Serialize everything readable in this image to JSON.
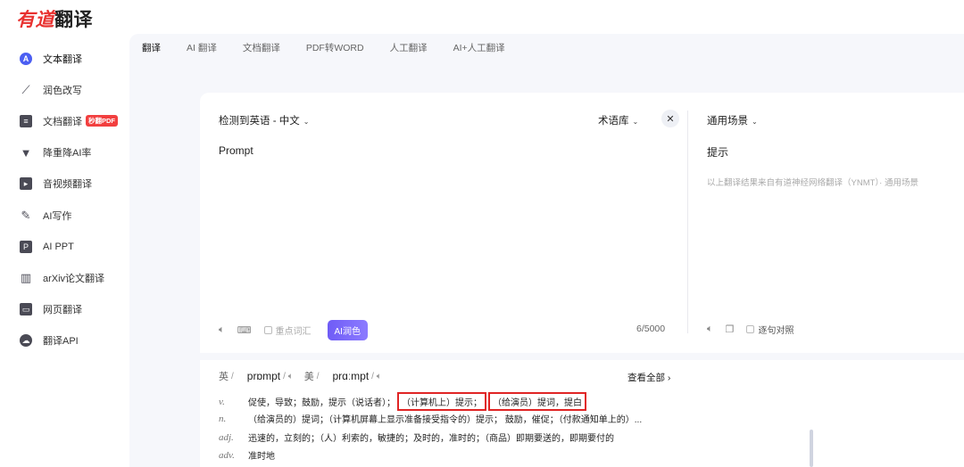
{
  "logo": {
    "red": "有道",
    "dark": "翻译"
  },
  "sidebar": {
    "items": [
      {
        "label": "文本翻译",
        "icon": "a-circle-icon"
      },
      {
        "label": "润色改写",
        "icon": "magic-wand-icon"
      },
      {
        "label": "文档翻译",
        "icon": "document-icon",
        "badge": "秒翻PDF"
      },
      {
        "label": "降重降AI率",
        "icon": "funnel-icon"
      },
      {
        "label": "音视频翻译",
        "icon": "video-icon"
      },
      {
        "label": "AI写作",
        "icon": "pen-icon"
      },
      {
        "label": "AI PPT",
        "icon": "ppt-icon"
      },
      {
        "label": "arXiv论文翻译",
        "icon": "books-icon"
      },
      {
        "label": "网页翻译",
        "icon": "webpage-icon"
      },
      {
        "label": "翻译API",
        "icon": "api-cloud-icon"
      }
    ]
  },
  "tabs": [
    "翻译",
    "AI 翻译",
    "文档翻译",
    "PDF转WORD",
    "人工翻译",
    "AI+人工翻译"
  ],
  "source": {
    "lang": "检测到英语 - 中文",
    "term_lib": "术语库",
    "text": "Prompt",
    "key_vocab": "重点词汇",
    "ai_polish": "AI润色",
    "count": "6/5000"
  },
  "target": {
    "scene": "通用场景",
    "text": "提示",
    "note": "以上翻译结果来自有道神经网络翻译（YNMT）· 通用场景",
    "sentence_align": "逐句对照"
  },
  "dict": {
    "uk_label": "英",
    "uk_ipa": "prɒmpt",
    "us_label": "美",
    "us_ipa": "prɑːmpt",
    "see_all": "查看全部",
    "defs": [
      {
        "pos": "v.",
        "text": "促使，导致；鼓励，提示（说话者）；",
        "hl1": "（计算机上）提示；",
        "hl2": "（给演员）提词，提白"
      },
      {
        "pos": "n.",
        "text": "（给演员的）提词；（计算机屏幕上显示准备接受指令的）提示； 鼓励，催促；（付款通知单上的）..."
      },
      {
        "pos": "adj.",
        "text": "迅速的，立刻的；（人）利索的，敏捷的；及时的，准时的；（商品）即期要送的，即期要付的"
      },
      {
        "pos": "adv.",
        "text": "准时地"
      }
    ]
  }
}
